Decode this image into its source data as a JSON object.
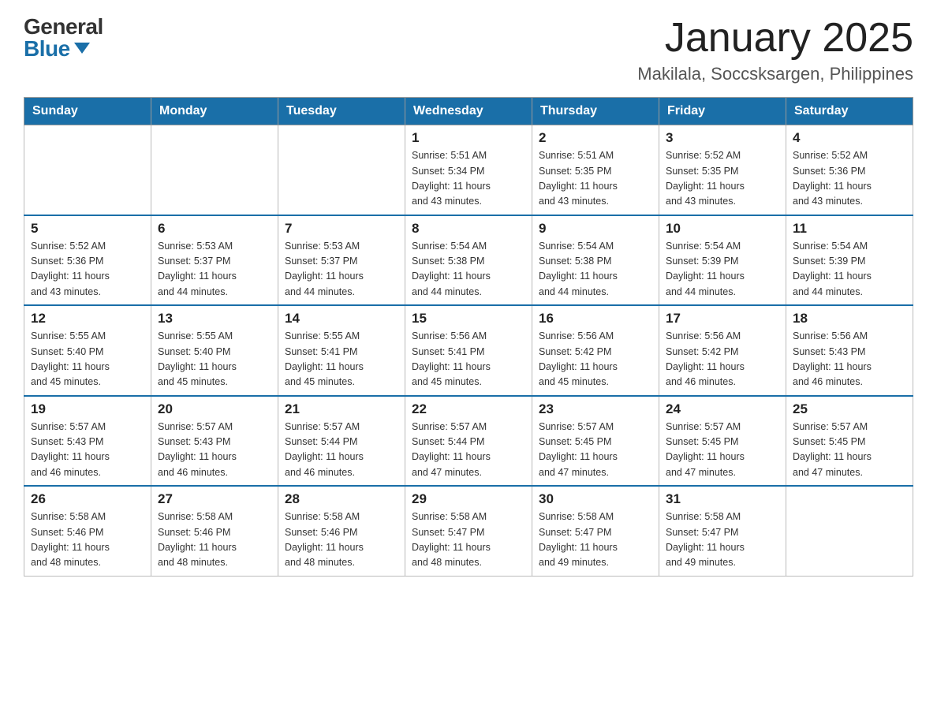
{
  "header": {
    "logo_general": "General",
    "logo_blue": "Blue",
    "title": "January 2025",
    "subtitle": "Makilala, Soccsksargen, Philippines"
  },
  "days_of_week": [
    "Sunday",
    "Monday",
    "Tuesday",
    "Wednesday",
    "Thursday",
    "Friday",
    "Saturday"
  ],
  "weeks": [
    [
      {
        "num": "",
        "info": ""
      },
      {
        "num": "",
        "info": ""
      },
      {
        "num": "",
        "info": ""
      },
      {
        "num": "1",
        "info": "Sunrise: 5:51 AM\nSunset: 5:34 PM\nDaylight: 11 hours\nand 43 minutes."
      },
      {
        "num": "2",
        "info": "Sunrise: 5:51 AM\nSunset: 5:35 PM\nDaylight: 11 hours\nand 43 minutes."
      },
      {
        "num": "3",
        "info": "Sunrise: 5:52 AM\nSunset: 5:35 PM\nDaylight: 11 hours\nand 43 minutes."
      },
      {
        "num": "4",
        "info": "Sunrise: 5:52 AM\nSunset: 5:36 PM\nDaylight: 11 hours\nand 43 minutes."
      }
    ],
    [
      {
        "num": "5",
        "info": "Sunrise: 5:52 AM\nSunset: 5:36 PM\nDaylight: 11 hours\nand 43 minutes."
      },
      {
        "num": "6",
        "info": "Sunrise: 5:53 AM\nSunset: 5:37 PM\nDaylight: 11 hours\nand 44 minutes."
      },
      {
        "num": "7",
        "info": "Sunrise: 5:53 AM\nSunset: 5:37 PM\nDaylight: 11 hours\nand 44 minutes."
      },
      {
        "num": "8",
        "info": "Sunrise: 5:54 AM\nSunset: 5:38 PM\nDaylight: 11 hours\nand 44 minutes."
      },
      {
        "num": "9",
        "info": "Sunrise: 5:54 AM\nSunset: 5:38 PM\nDaylight: 11 hours\nand 44 minutes."
      },
      {
        "num": "10",
        "info": "Sunrise: 5:54 AM\nSunset: 5:39 PM\nDaylight: 11 hours\nand 44 minutes."
      },
      {
        "num": "11",
        "info": "Sunrise: 5:54 AM\nSunset: 5:39 PM\nDaylight: 11 hours\nand 44 minutes."
      }
    ],
    [
      {
        "num": "12",
        "info": "Sunrise: 5:55 AM\nSunset: 5:40 PM\nDaylight: 11 hours\nand 45 minutes."
      },
      {
        "num": "13",
        "info": "Sunrise: 5:55 AM\nSunset: 5:40 PM\nDaylight: 11 hours\nand 45 minutes."
      },
      {
        "num": "14",
        "info": "Sunrise: 5:55 AM\nSunset: 5:41 PM\nDaylight: 11 hours\nand 45 minutes."
      },
      {
        "num": "15",
        "info": "Sunrise: 5:56 AM\nSunset: 5:41 PM\nDaylight: 11 hours\nand 45 minutes."
      },
      {
        "num": "16",
        "info": "Sunrise: 5:56 AM\nSunset: 5:42 PM\nDaylight: 11 hours\nand 45 minutes."
      },
      {
        "num": "17",
        "info": "Sunrise: 5:56 AM\nSunset: 5:42 PM\nDaylight: 11 hours\nand 46 minutes."
      },
      {
        "num": "18",
        "info": "Sunrise: 5:56 AM\nSunset: 5:43 PM\nDaylight: 11 hours\nand 46 minutes."
      }
    ],
    [
      {
        "num": "19",
        "info": "Sunrise: 5:57 AM\nSunset: 5:43 PM\nDaylight: 11 hours\nand 46 minutes."
      },
      {
        "num": "20",
        "info": "Sunrise: 5:57 AM\nSunset: 5:43 PM\nDaylight: 11 hours\nand 46 minutes."
      },
      {
        "num": "21",
        "info": "Sunrise: 5:57 AM\nSunset: 5:44 PM\nDaylight: 11 hours\nand 46 minutes."
      },
      {
        "num": "22",
        "info": "Sunrise: 5:57 AM\nSunset: 5:44 PM\nDaylight: 11 hours\nand 47 minutes."
      },
      {
        "num": "23",
        "info": "Sunrise: 5:57 AM\nSunset: 5:45 PM\nDaylight: 11 hours\nand 47 minutes."
      },
      {
        "num": "24",
        "info": "Sunrise: 5:57 AM\nSunset: 5:45 PM\nDaylight: 11 hours\nand 47 minutes."
      },
      {
        "num": "25",
        "info": "Sunrise: 5:57 AM\nSunset: 5:45 PM\nDaylight: 11 hours\nand 47 minutes."
      }
    ],
    [
      {
        "num": "26",
        "info": "Sunrise: 5:58 AM\nSunset: 5:46 PM\nDaylight: 11 hours\nand 48 minutes."
      },
      {
        "num": "27",
        "info": "Sunrise: 5:58 AM\nSunset: 5:46 PM\nDaylight: 11 hours\nand 48 minutes."
      },
      {
        "num": "28",
        "info": "Sunrise: 5:58 AM\nSunset: 5:46 PM\nDaylight: 11 hours\nand 48 minutes."
      },
      {
        "num": "29",
        "info": "Sunrise: 5:58 AM\nSunset: 5:47 PM\nDaylight: 11 hours\nand 48 minutes."
      },
      {
        "num": "30",
        "info": "Sunrise: 5:58 AM\nSunset: 5:47 PM\nDaylight: 11 hours\nand 49 minutes."
      },
      {
        "num": "31",
        "info": "Sunrise: 5:58 AM\nSunset: 5:47 PM\nDaylight: 11 hours\nand 49 minutes."
      },
      {
        "num": "",
        "info": ""
      }
    ]
  ]
}
